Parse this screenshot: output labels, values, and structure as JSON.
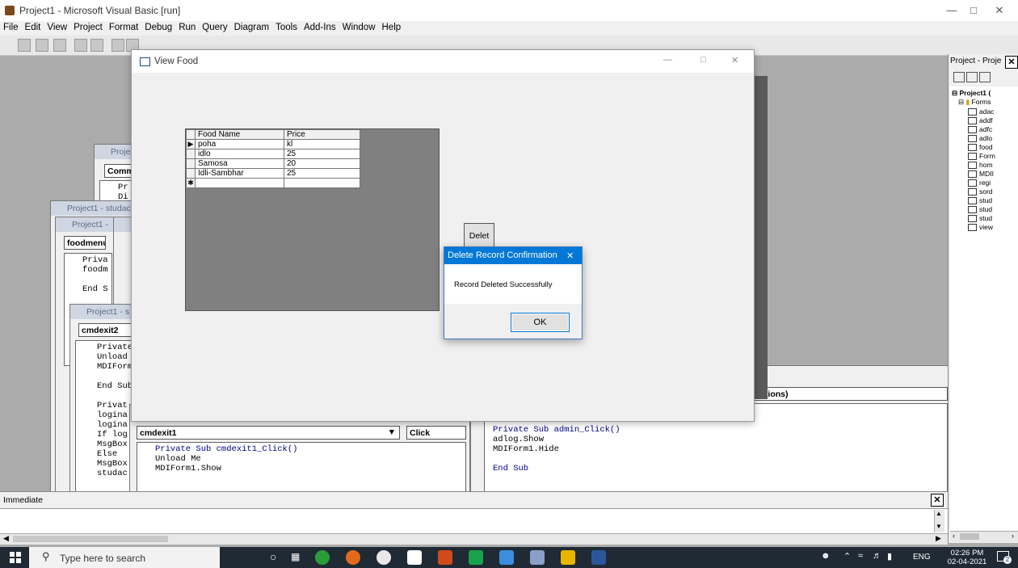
{
  "window": {
    "title": "Project1 - Microsoft Visual Basic [run]"
  },
  "menu": [
    "File",
    "Edit",
    "View",
    "Project",
    "Format",
    "Debug",
    "Run",
    "Query",
    "Diagram",
    "Tools",
    "Add-Ins",
    "Window",
    "Help"
  ],
  "code_windows": {
    "w1": {
      "caption": "Proje",
      "combo": "Comm",
      "lines": [
        "Pr",
        "Di"
      ]
    },
    "w2": {
      "caption": "Project1 - studac"
    },
    "w3": {
      "caption": "Project1 -",
      "combo": "foodmenu",
      "lines": [
        "Priva",
        "foodm",
        "",
        "End S"
      ]
    },
    "w4": {
      "caption": "Project1 - s",
      "combo": "cmdexit2",
      "lines": [
        "Private",
        "Unload",
        "MDIForm",
        "",
        "End Sub",
        "",
        "Privat",
        "logina",
        "logina",
        "If log",
        "MsgBox",
        "Else",
        "MsgBox",
        "studac"
      ]
    },
    "w5": {
      "combo": "cmdexit1",
      "proc": "Click",
      "lines": [
        "Private Sub cmdexit1_Click()",
        "Unload Me",
        "MDIForm1.Show"
      ]
    },
    "w6": {
      "combo": "rations)",
      "lines": [
        "Private Sub admin_Click()",
        "adlog.Show",
        "MDIForm1.Hide",
        "",
        "End Sub"
      ]
    }
  },
  "view_food": {
    "title": "View Food",
    "grid": {
      "columns": [
        "Food Name",
        "Price"
      ],
      "rows": [
        [
          "poha",
          "kl"
        ],
        [
          "idlo",
          "25"
        ],
        [
          "Samosa",
          "20"
        ],
        [
          "Idli-Sambhar",
          "25"
        ]
      ]
    },
    "delete_label": "Delet"
  },
  "msgbox": {
    "title": "Delete Record Confirmation",
    "message": "Record Deleted Successfully",
    "ok_label": "OK"
  },
  "project_panel": {
    "title": "Project - Proje",
    "root": "Project1 (",
    "folder": "Forms",
    "items": [
      "adac",
      "addf",
      "adfc",
      "adlo",
      "food",
      "Form",
      "hom",
      "MDII",
      "regi",
      "sord",
      "stud",
      "stud",
      "stud",
      "view"
    ]
  },
  "immediate": {
    "title": "Immediate"
  },
  "taskbar": {
    "search_placeholder": "Type here to search",
    "language": "ENG",
    "time": "02:26 PM",
    "date": "02-04-2021",
    "notifications": "2"
  }
}
